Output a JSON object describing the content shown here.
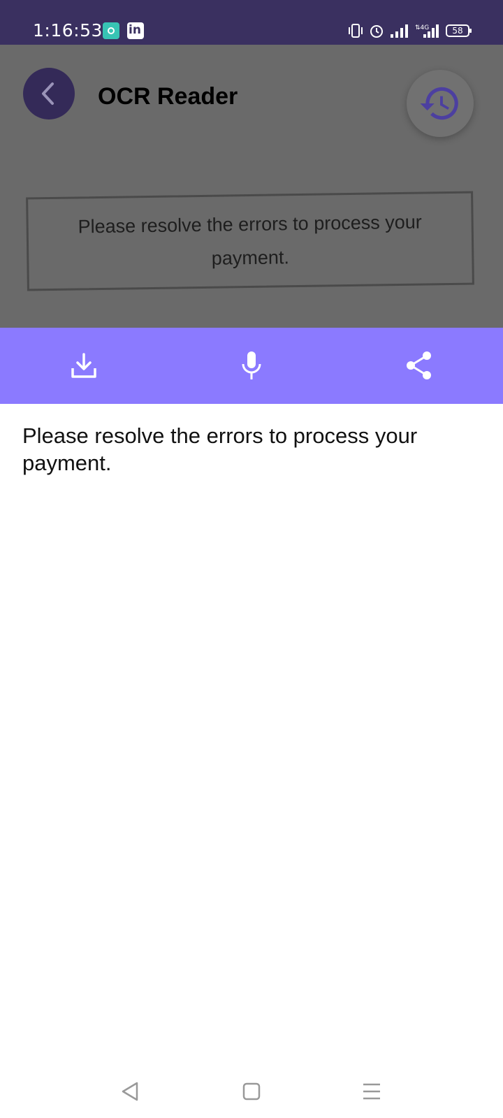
{
  "status_bar": {
    "time": "1:16:53",
    "battery": "58",
    "icons": [
      "notification-app-icon",
      "linkedin-icon",
      "vibrate-icon",
      "alarm-icon",
      "signal-icon",
      "4g-signal-icon",
      "battery-icon"
    ]
  },
  "header": {
    "title": "OCR Reader",
    "back_icon": "chevron-left-icon",
    "history_icon": "history-icon"
  },
  "preview": {
    "scanned_text": "Please resolve the errors to process your payment."
  },
  "actions": [
    {
      "name": "download",
      "icon": "download-icon"
    },
    {
      "name": "speak",
      "icon": "microphone-icon"
    },
    {
      "name": "share",
      "icon": "share-icon"
    }
  ],
  "result": {
    "text": "Please resolve the errors to process your payment."
  },
  "colors": {
    "status_bar": "#3a3060",
    "accent": "#8b7aff",
    "back_button": "#342a58",
    "history_icon": "#4c3fa0",
    "dim_overlay": "#6a6a6a"
  }
}
